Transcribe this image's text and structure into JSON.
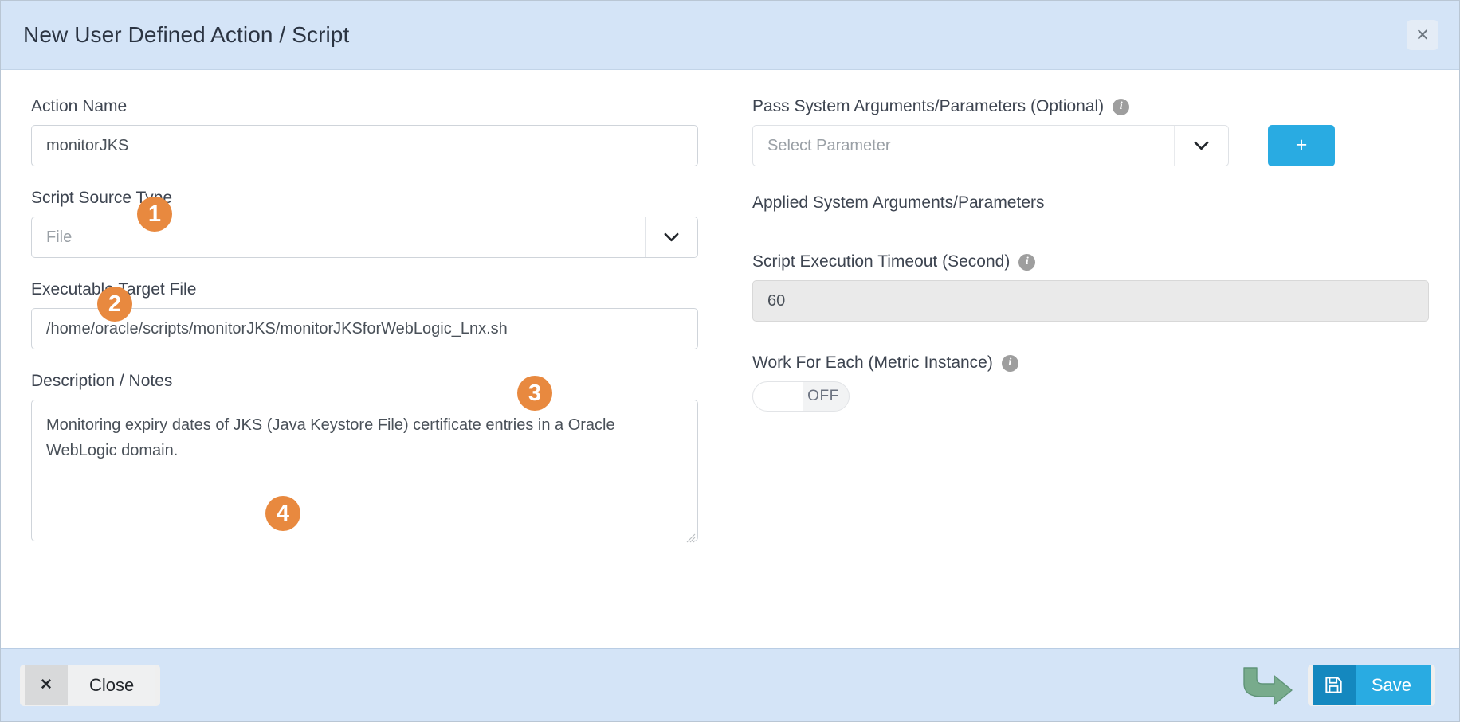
{
  "header": {
    "title": "New User Defined Action / Script",
    "close_icon": "close-icon",
    "close_glyph": "✕"
  },
  "left_column": {
    "action_name": {
      "label": "Action Name",
      "value": "monitorJKS",
      "placeholder": ""
    },
    "script_source_type": {
      "label": "Script Source Type",
      "value": "File",
      "caret_icon": "chevron-down-icon"
    },
    "executable_target_file": {
      "label": "Executable Target File",
      "value": "/home/oracle/scripts/monitorJKS/monitorJKSforWebLogic_Lnx.sh",
      "placeholder": ""
    },
    "description": {
      "label": "Description / Notes",
      "value": "Monitoring expiry dates of JKS (Java Keystore File) certificate entries in a Oracle WebLogic domain.",
      "placeholder": ""
    }
  },
  "right_column": {
    "pass_system_arguments": {
      "label": "Pass System Arguments/Parameters (Optional)",
      "info_icon": "info-icon",
      "info_glyph": "i",
      "select_placeholder": "Select Parameter",
      "select_value": "",
      "caret_icon": "chevron-down-icon",
      "add_button_label": "+"
    },
    "applied_system_arguments": {
      "label": "Applied System Arguments/Parameters"
    },
    "script_execution_timeout": {
      "label": "Script Execution Timeout (Second)",
      "info_icon": "info-icon",
      "info_glyph": "i",
      "value": "60"
    },
    "work_for_each": {
      "label": "Work For Each (Metric Instance)",
      "info_icon": "info-icon",
      "info_glyph": "i",
      "toggle_state": "OFF"
    }
  },
  "footer": {
    "close_button": {
      "icon_glyph": "✕",
      "label": "Close"
    },
    "save_button": {
      "icon": "save-floppy-icon",
      "label": "Save"
    },
    "annotation_arrow": "green-curved-arrow"
  },
  "callouts": [
    {
      "number": "1",
      "target": "action-name-input"
    },
    {
      "number": "2",
      "target": "script-source-type-select"
    },
    {
      "number": "3",
      "target": "executable-target-file-input"
    },
    {
      "number": "4",
      "target": "description-notes-textarea"
    }
  ],
  "colors": {
    "header_bg": "#d4e4f7",
    "footer_bg": "#d4e4f7",
    "accent_blue": "#29abe2",
    "accent_blue_dark": "#1488bf",
    "badge_orange": "#e8893f",
    "arrow_green": "#78ab8c",
    "readonly_gray": "#eaeaea"
  }
}
